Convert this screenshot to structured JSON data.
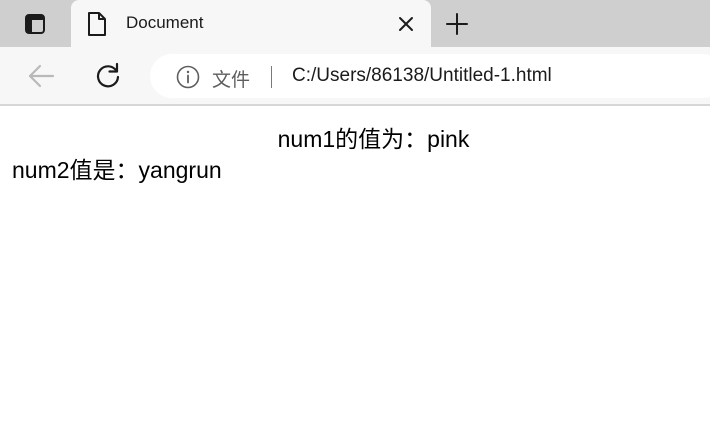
{
  "browser": {
    "tab": {
      "title": "Document"
    },
    "address_bar": {
      "scheme_label": "文件",
      "url": "C:/Users/86138/Untitled-1.html"
    }
  },
  "page": {
    "line1": "num1的值为：pink",
    "line2": "num2值是：yangrun"
  },
  "colors": {
    "tabbar_bg": "#cfcfcf",
    "toolbar_bg": "#f7f7f7",
    "address_bg": "#ffffff",
    "text": "#1b1b1b"
  }
}
